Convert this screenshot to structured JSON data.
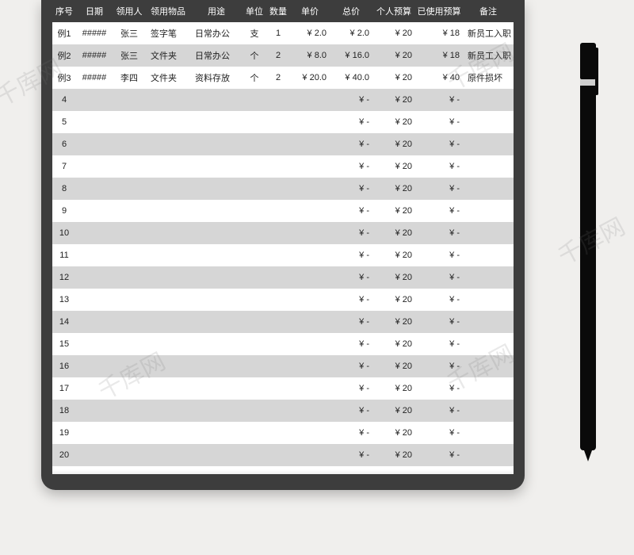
{
  "headers": [
    "序号",
    "日期",
    "领用人",
    "领用物品",
    "用途",
    "单位",
    "数量",
    "单价",
    "总价",
    "个人预算",
    "已使用预算",
    "备注"
  ],
  "rows": [
    {
      "seq": "例1",
      "date": "#####",
      "person": "张三",
      "item": "签字笔",
      "purpose": "日常办公",
      "unit": "支",
      "qty": "1",
      "unit_price": "2.0",
      "total": "2.0",
      "budget": "20",
      "used": "18",
      "note": "新员工入职"
    },
    {
      "seq": "例2",
      "date": "#####",
      "person": "张三",
      "item": "文件夹",
      "purpose": "日常办公",
      "unit": "个",
      "qty": "2",
      "unit_price": "8.0",
      "total": "16.0",
      "budget": "20",
      "used": "18",
      "note": "新员工入职"
    },
    {
      "seq": "例3",
      "date": "#####",
      "person": "李四",
      "item": "文件夹",
      "purpose": "资料存放",
      "unit": "个",
      "qty": "2",
      "unit_price": "20.0",
      "total": "40.0",
      "budget": "20",
      "used": "40",
      "note": "原件损坏"
    },
    {
      "seq": "4",
      "date": "",
      "person": "",
      "item": "",
      "purpose": "",
      "unit": "",
      "qty": "",
      "unit_price": "",
      "total": "-",
      "budget": "20",
      "used": "-",
      "note": ""
    },
    {
      "seq": "5",
      "date": "",
      "person": "",
      "item": "",
      "purpose": "",
      "unit": "",
      "qty": "",
      "unit_price": "",
      "total": "-",
      "budget": "20",
      "used": "-",
      "note": ""
    },
    {
      "seq": "6",
      "date": "",
      "person": "",
      "item": "",
      "purpose": "",
      "unit": "",
      "qty": "",
      "unit_price": "",
      "total": "-",
      "budget": "20",
      "used": "-",
      "note": ""
    },
    {
      "seq": "7",
      "date": "",
      "person": "",
      "item": "",
      "purpose": "",
      "unit": "",
      "qty": "",
      "unit_price": "",
      "total": "-",
      "budget": "20",
      "used": "-",
      "note": ""
    },
    {
      "seq": "8",
      "date": "",
      "person": "",
      "item": "",
      "purpose": "",
      "unit": "",
      "qty": "",
      "unit_price": "",
      "total": "-",
      "budget": "20",
      "used": "-",
      "note": ""
    },
    {
      "seq": "9",
      "date": "",
      "person": "",
      "item": "",
      "purpose": "",
      "unit": "",
      "qty": "",
      "unit_price": "",
      "total": "-",
      "budget": "20",
      "used": "-",
      "note": ""
    },
    {
      "seq": "10",
      "date": "",
      "person": "",
      "item": "",
      "purpose": "",
      "unit": "",
      "qty": "",
      "unit_price": "",
      "total": "-",
      "budget": "20",
      "used": "-",
      "note": ""
    },
    {
      "seq": "11",
      "date": "",
      "person": "",
      "item": "",
      "purpose": "",
      "unit": "",
      "qty": "",
      "unit_price": "",
      "total": "-",
      "budget": "20",
      "used": "-",
      "note": ""
    },
    {
      "seq": "12",
      "date": "",
      "person": "",
      "item": "",
      "purpose": "",
      "unit": "",
      "qty": "",
      "unit_price": "",
      "total": "-",
      "budget": "20",
      "used": "-",
      "note": ""
    },
    {
      "seq": "13",
      "date": "",
      "person": "",
      "item": "",
      "purpose": "",
      "unit": "",
      "qty": "",
      "unit_price": "",
      "total": "-",
      "budget": "20",
      "used": "-",
      "note": ""
    },
    {
      "seq": "14",
      "date": "",
      "person": "",
      "item": "",
      "purpose": "",
      "unit": "",
      "qty": "",
      "unit_price": "",
      "total": "-",
      "budget": "20",
      "used": "-",
      "note": ""
    },
    {
      "seq": "15",
      "date": "",
      "person": "",
      "item": "",
      "purpose": "",
      "unit": "",
      "qty": "",
      "unit_price": "",
      "total": "-",
      "budget": "20",
      "used": "-",
      "note": ""
    },
    {
      "seq": "16",
      "date": "",
      "person": "",
      "item": "",
      "purpose": "",
      "unit": "",
      "qty": "",
      "unit_price": "",
      "total": "-",
      "budget": "20",
      "used": "-",
      "note": ""
    },
    {
      "seq": "17",
      "date": "",
      "person": "",
      "item": "",
      "purpose": "",
      "unit": "",
      "qty": "",
      "unit_price": "",
      "total": "-",
      "budget": "20",
      "used": "-",
      "note": ""
    },
    {
      "seq": "18",
      "date": "",
      "person": "",
      "item": "",
      "purpose": "",
      "unit": "",
      "qty": "",
      "unit_price": "",
      "total": "-",
      "budget": "20",
      "used": "-",
      "note": ""
    },
    {
      "seq": "19",
      "date": "",
      "person": "",
      "item": "",
      "purpose": "",
      "unit": "",
      "qty": "",
      "unit_price": "",
      "total": "-",
      "budget": "20",
      "used": "-",
      "note": ""
    },
    {
      "seq": "20",
      "date": "",
      "person": "",
      "item": "",
      "purpose": "",
      "unit": "",
      "qty": "",
      "unit_price": "",
      "total": "-",
      "budget": "20",
      "used": "-",
      "note": ""
    }
  ],
  "currency": "¥",
  "watermark": "千库网"
}
